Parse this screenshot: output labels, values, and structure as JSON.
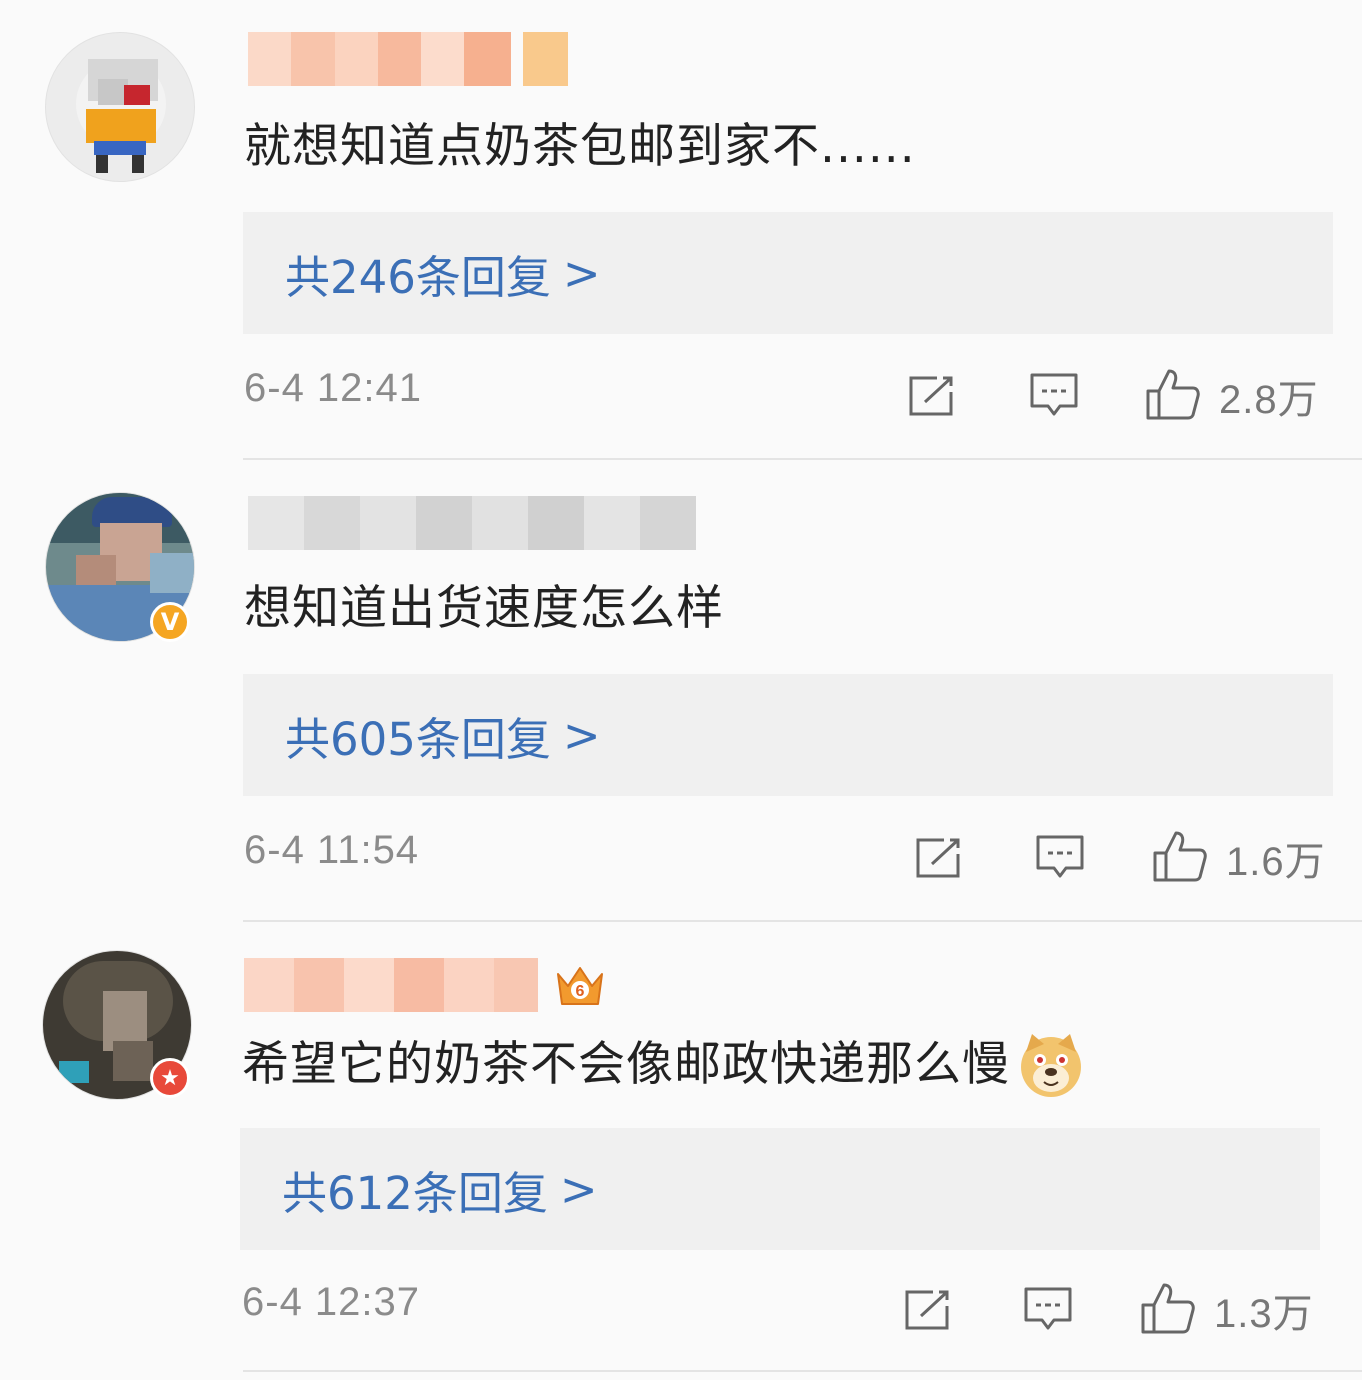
{
  "comments": [
    {
      "text": "就想知道点奶茶包邮到家不......",
      "reply_label": "共246条回复",
      "reply_arrow": ">",
      "time": "6-4 12:41",
      "likes": "2.8万",
      "avatar_badge": "",
      "username_badge": ""
    },
    {
      "text": "想知道出货速度怎么样",
      "reply_label": "共605条回复",
      "reply_arrow": ">",
      "time": "6-4 11:54",
      "likes": "1.6万",
      "avatar_badge": "V",
      "username_badge": ""
    },
    {
      "text": "希望它的奶茶不会像邮政快递那么慢",
      "reply_label": "共612条回复",
      "reply_arrow": ">",
      "time": "6-4 12:37",
      "likes": "1.3万",
      "avatar_badge": "★",
      "username_badge": "6"
    }
  ],
  "icons": {
    "repost": "repost-icon",
    "comment": "comment-icon",
    "like": "thumbs-up-icon",
    "emoji": "doge-emoji-icon",
    "crown": "vip-crown-icon"
  },
  "colors": {
    "link": "#3b6fb6",
    "verified_badge": "#f5a623",
    "star_badge": "#e8493a",
    "crown": "#f29a2e"
  }
}
